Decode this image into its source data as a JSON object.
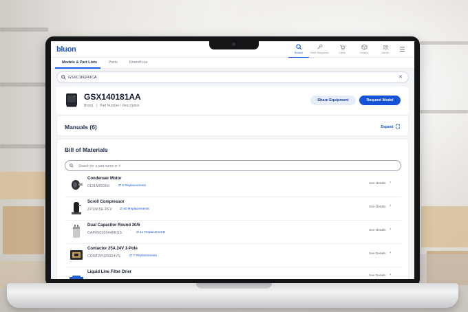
{
  "app": {
    "logo": "bluon"
  },
  "nav": [
    {
      "label": "Search",
      "icon": "search-icon",
      "active": true
    },
    {
      "label": "Field Requests",
      "icon": "wrench-icon",
      "active": false
    },
    {
      "label": "Carts",
      "icon": "cart-icon",
      "active": false
    },
    {
      "label": "Orders",
      "icon": "orders-icon",
      "active": false
    },
    {
      "label": "Admin",
      "icon": "admin-icon",
      "active": false
    }
  ],
  "tabs": [
    "Models & Part Lists",
    "Parts",
    "Brand/Line"
  ],
  "search": {
    "value": "GSXC160241CA"
  },
  "product": {
    "model": "GSX140181AA",
    "brand_label": "Brand",
    "separator": "|",
    "part_label": "Part Number / Description",
    "share_label": "Share Equipment",
    "request_label": "Request Model"
  },
  "manuals": {
    "title": "Manuals (6)",
    "expand_label": "Expand"
  },
  "bom": {
    "title": "Bill of Materials",
    "search_placeholder": "Search for a part name or #",
    "details_label": "See Details",
    "items": [
      {
        "name": "Condenser Motor",
        "number": "0131M00266",
        "replacements": "5 Replacements"
      },
      {
        "name": "Scroll Compressor",
        "number": "ZP16K5E-PFV",
        "replacements": "60 Replacements"
      },
      {
        "name": "Dual Capacitor Round 30/5",
        "number": "CAP050300440RSS",
        "replacements": "11 Replacements"
      },
      {
        "name": "Contactor 25A 24V 1-Pole",
        "number": "CONT2P025024VS",
        "replacements": "7 Replacements"
      },
      {
        "name": "Liquid Line Filter Drier",
        "number": "",
        "replacements": ""
      }
    ]
  },
  "colors": {
    "accent": "#1553d6",
    "text_dark": "#111a2e",
    "muted": "#757b88"
  }
}
